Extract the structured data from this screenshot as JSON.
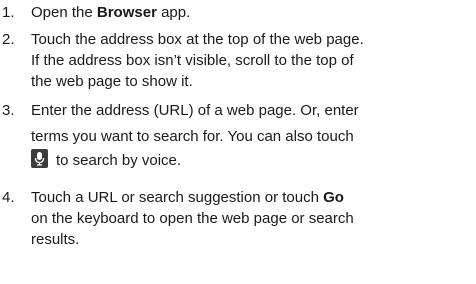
{
  "steps": [
    {
      "number": "1.",
      "lines": [
        {
          "pre": "Open the ",
          "bold": "Browser",
          "post": " app."
        }
      ]
    },
    {
      "number": "2.",
      "lines": [
        {
          "text": "Touch the address box at the top of the web page."
        },
        {
          "text": "If the address box isn’t visible, scroll to the top of"
        },
        {
          "text": "the web page to show it."
        }
      ]
    },
    {
      "number": "3.",
      "lines": [
        {
          "text": "Enter the address (URL) of a web page. Or, enter"
        },
        {
          "text": "terms you want to search for. You can also touch"
        },
        {
          "text": "to search by voice."
        }
      ],
      "icon": "microphone-icon"
    },
    {
      "number": "4.",
      "lines": [
        {
          "pre": "Touch a URL or search suggestion or touch ",
          "bold": "Go"
        },
        {
          "text": "on the keyboard to open the web page or search"
        },
        {
          "text": "results."
        }
      ]
    }
  ]
}
